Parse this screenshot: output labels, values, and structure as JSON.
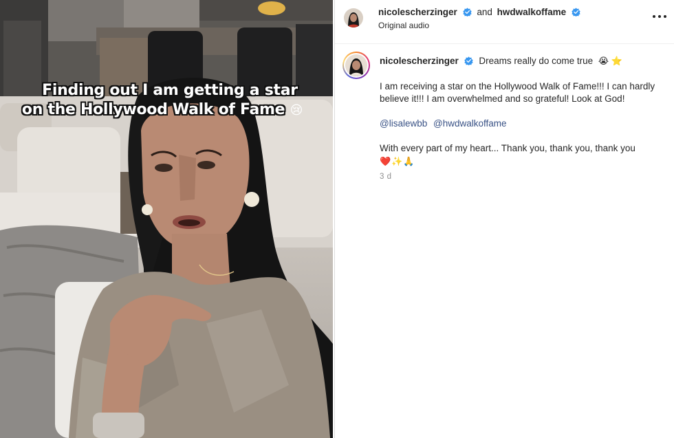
{
  "video": {
    "caption_line1": "Finding out I am getting a star",
    "caption_line2": "on the Hollywood Walk of Fame",
    "caption_emoji": "😢"
  },
  "post": {
    "header": {
      "author": "nicolescherzinger",
      "connector": "and",
      "coauthor": "hwdwalkoffame",
      "audio": "Original audio",
      "more_icon": "more-horizontal-icon"
    },
    "caption": {
      "author": "nicolescherzinger",
      "title_text": "Dreams really do come true",
      "title_emoji": "😭 ⭐",
      "body": "I am receiving a star on the Hollywood Walk of Fame!!! I can hardly believe it!!! I am overwhelmed and so grateful! Look at God!",
      "mentions": [
        "@lisalewbb",
        "@hwdwalkoffame"
      ],
      "closing": "With every part of my heart... Thank you, thank you, thank you",
      "closing_emoji": "❤️✨🙏",
      "timestamp": "3 d"
    },
    "colors": {
      "verified": "#3897f0",
      "mention": "#385185",
      "muted": "#8e8e8e"
    }
  }
}
